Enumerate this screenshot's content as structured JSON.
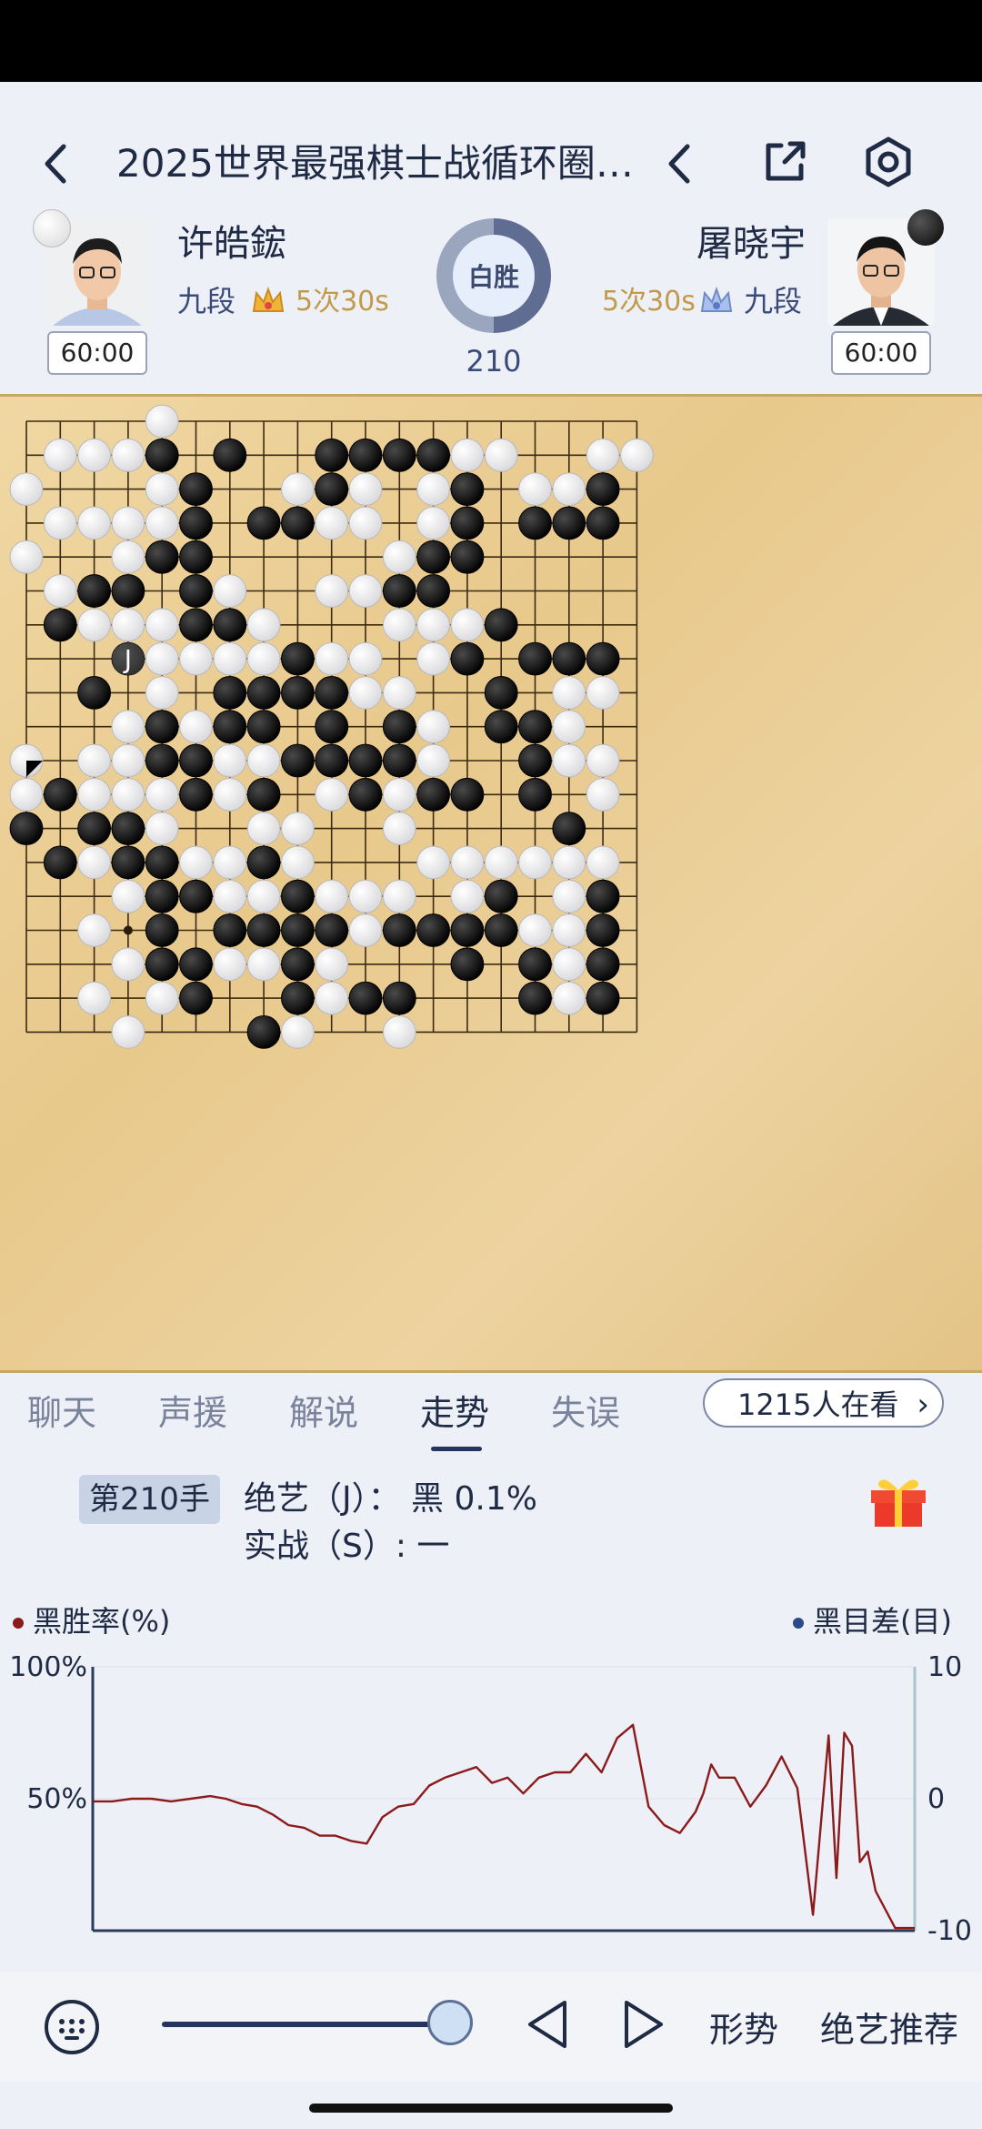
{
  "header": {
    "title": "2025世界最强棋士战循环圈…"
  },
  "players": {
    "white": {
      "name": "许皓鋐",
      "rank": "九段",
      "byoyomi": "5次30s",
      "clock": "60:00",
      "stone": "white"
    },
    "black": {
      "name": "屠晓宇",
      "rank": "九段",
      "byoyomi": "5次30s",
      "clock": "60:00",
      "stone": "black"
    }
  },
  "result": {
    "label": "白胜",
    "move_count": "210"
  },
  "board": {
    "size": 19,
    "ai_marker_label": "J",
    "rows": [
      "....W..............",
      ".WWWB.B..BBBBWW..WW",
      "W...WB..WBW.WB.WWB.",
      ".WWWWB.BBWW.WB.BBB.",
      "W..WBB.....WBB.....",
      ".WBB.BW..WWBB......",
      ".BWWWBBW...WWWB....",
      "...BWWWWBWW.WB.BBB.",
      "..B.W.BBBBWW..B.WW.",
      "...WBWBB.B.BW.BBW..",
      "W.WWBBWWBBBBW..BWW.",
      "WBWWWBWB.WBWBB.B.W.",
      "B.BBW..WW..W....B..",
      ".BWBBWWBW...WWWWWW.",
      "...WBBWWBWWW.WB.WB.",
      "..W.B.BBBBWBBBBWWB.",
      "...WBBWWBW...B.BWB.",
      "..W.WB..BWBB...BWB.",
      "...W...BW..W......."
    ]
  },
  "tabs": [
    "聊天",
    "声援",
    "解说",
    "走势",
    "失误"
  ],
  "active_tab": "走势",
  "viewers": "1215人在看",
  "analysis": {
    "move_badge": "第210手",
    "ai_line": "绝艺（J）：  黑  0.1%",
    "actual_line": "实战（S）: 一"
  },
  "chart_legend": {
    "left": "黑胜率(%)",
    "right": "黑目差(目)",
    "left_color": "#8b1a1a",
    "right_color": "#2a4a8a"
  },
  "chart_data": {
    "type": "line",
    "xlim": [
      0,
      210
    ],
    "ylim": [
      0,
      100
    ],
    "y_right_lim": [
      -10,
      10
    ],
    "y_ticks_left": [
      "100%",
      "50%",
      ""
    ],
    "y_ticks_right": [
      "10",
      "0",
      "-10"
    ],
    "series": [
      {
        "x": [
          0,
          5,
          10,
          15,
          20,
          25,
          30,
          34,
          38,
          42,
          46,
          50,
          54,
          58,
          62,
          66,
          70,
          74,
          78,
          82,
          86,
          90,
          94,
          98,
          102,
          106,
          110,
          114,
          118,
          122,
          126,
          130,
          134,
          138,
          142,
          146,
          150,
          154,
          156,
          158,
          160,
          164,
          168,
          172,
          176,
          180,
          184,
          188,
          190,
          192,
          194,
          196,
          198,
          200,
          205,
          210
        ],
        "values": [
          49,
          49,
          50,
          50,
          49,
          50,
          51,
          50,
          48,
          47,
          44,
          40,
          39,
          36,
          36,
          34,
          33,
          43,
          47,
          48,
          55,
          58,
          60,
          62,
          56,
          58,
          52,
          58,
          60,
          60,
          67,
          60,
          73,
          78,
          47,
          40,
          37,
          45,
          52,
          63,
          58,
          58,
          47,
          55,
          66,
          54,
          6,
          74,
          20,
          75,
          70,
          26,
          30,
          15,
          1,
          1
        ]
      }
    ]
  },
  "bottom": {
    "slider_value": 1.0,
    "prev_label": "",
    "next_label": "",
    "situation_label": "形势",
    "ai_recommend_label": "绝艺推荐"
  },
  "icons": {
    "back": "back-arrow-icon",
    "undo": "chevron-left-icon",
    "share": "share-icon",
    "settings": "settings-icon",
    "keyboard": "keyboard-icon",
    "gift": "gift-icon",
    "crown": "crown-icon"
  }
}
